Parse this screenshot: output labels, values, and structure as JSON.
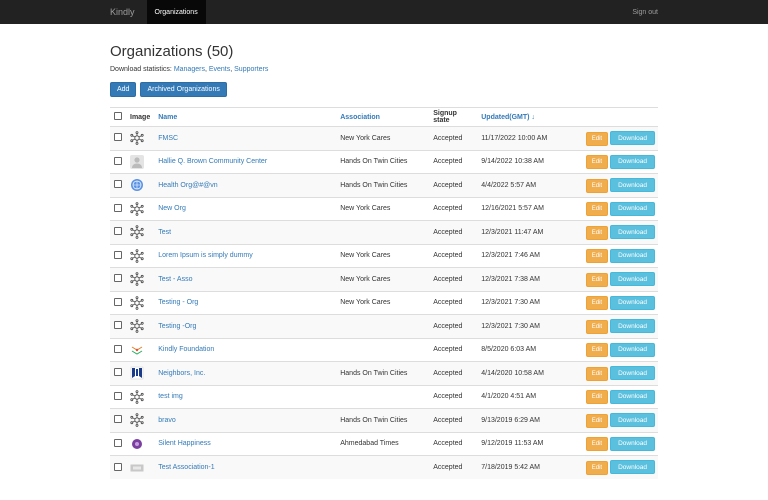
{
  "nav": {
    "brand": "Kindly",
    "active_tab": "Organizations",
    "signout": "Sign out"
  },
  "page": {
    "title": "Organizations (50)",
    "stats_prefix": "Download statistics: ",
    "stats_links": [
      "Managers",
      "Events",
      "Supporters"
    ],
    "add_label": "Add",
    "archived_label": "Archived Organizations"
  },
  "table": {
    "headers": {
      "image": "Image",
      "name": "Name",
      "association": "Association",
      "signup": "Signup state",
      "updated": "Updated(GMT) ↓"
    },
    "edit_label": "Edit",
    "download_label": "Download",
    "rows": [
      {
        "image": "network-logo-icon",
        "name": "FMSC",
        "association": "New York Cares",
        "signup": "Accepted",
        "updated": "11/17/2022 10:00 AM"
      },
      {
        "image": "avatar-placeholder-icon",
        "name": "Hallie Q. Brown Community Center",
        "association": "Hands On Twin Cities",
        "signup": "Accepted",
        "updated": "9/14/2022 10:38 AM"
      },
      {
        "image": "un-emblem-icon",
        "name": "Health Org@#@vn",
        "association": "Hands On Twin Cities",
        "signup": "Accepted",
        "updated": "4/4/2022 5:57 AM"
      },
      {
        "image": "network-logo-icon",
        "name": "New Org",
        "association": "New York Cares",
        "signup": "Accepted",
        "updated": "12/16/2021 5:57 AM"
      },
      {
        "image": "network-logo-icon",
        "name": "Test",
        "association": "",
        "signup": "Accepted",
        "updated": "12/3/2021 11:47 AM"
      },
      {
        "image": "network-logo-icon",
        "name": "Lorem Ipsum is simply dummy",
        "association": "New York Cares",
        "signup": "Accepted",
        "updated": "12/3/2021 7:46 AM"
      },
      {
        "image": "network-logo-icon",
        "name": "Test - Asso",
        "association": "New York Cares",
        "signup": "Accepted",
        "updated": "12/3/2021 7:38 AM"
      },
      {
        "image": "network-logo-icon",
        "name": "Testing - Org",
        "association": "New York Cares",
        "signup": "Accepted",
        "updated": "12/3/2021 7:30 AM"
      },
      {
        "image": "network-logo-icon",
        "name": "Testing -Org",
        "association": "",
        "signup": "Accepted",
        "updated": "12/3/2021 7:30 AM"
      },
      {
        "image": "colorful-logo-icon",
        "name": "Kindly Foundation",
        "association": "",
        "signup": "Accepted",
        "updated": "8/5/2020 6:03 AM"
      },
      {
        "image": "blue-banner-logo-icon",
        "name": "Neighbors, Inc.",
        "association": "Hands On Twin Cities",
        "signup": "Accepted",
        "updated": "4/14/2020 10:58 AM"
      },
      {
        "image": "network-logo-icon",
        "name": "test img",
        "association": "",
        "signup": "Accepted",
        "updated": "4/1/2020 4:51 AM"
      },
      {
        "image": "network-logo-icon",
        "name": "bravo",
        "association": "Hands On Twin Cities",
        "signup": "Accepted",
        "updated": "9/13/2019 6:29 AM"
      },
      {
        "image": "purple-flower-icon",
        "name": "Silent Happiness",
        "association": "Ahmedabad Times",
        "signup": "Accepted",
        "updated": "9/12/2019 11:53 AM"
      },
      {
        "image": "grey-card-icon",
        "name": "Test Association-1",
        "association": "",
        "signup": "Accepted",
        "updated": "7/18/2019 5:42 AM"
      }
    ]
  }
}
